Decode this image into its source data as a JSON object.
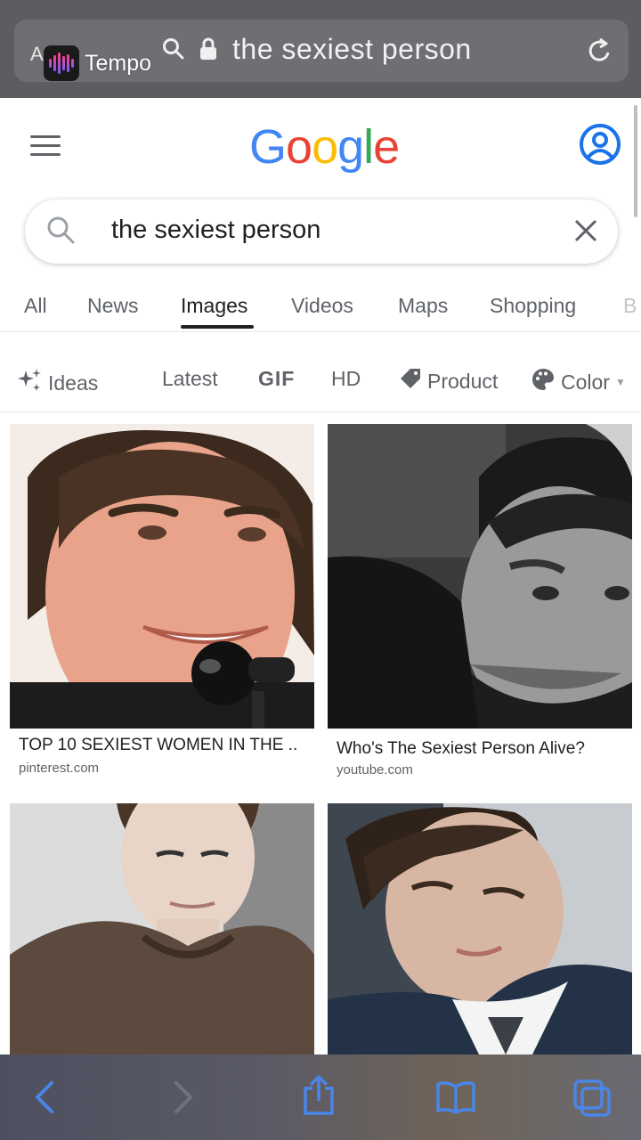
{
  "browser": {
    "aa_label": "A",
    "url_text": "the sexiest person",
    "overlay_app_name": "Tempo"
  },
  "google": {
    "logo_letters": [
      {
        "ch": "G",
        "color": "#4285f4"
      },
      {
        "ch": "o",
        "color": "#ea4335"
      },
      {
        "ch": "o",
        "color": "#fbbc05"
      },
      {
        "ch": "g",
        "color": "#4285f4"
      },
      {
        "ch": "l",
        "color": "#34a853"
      },
      {
        "ch": "e",
        "color": "#ea4335"
      }
    ],
    "search_query": "the sexiest person"
  },
  "tabs": [
    {
      "label": "All"
    },
    {
      "label": "News"
    },
    {
      "label": "Images",
      "active": true
    },
    {
      "label": "Videos"
    },
    {
      "label": "Maps"
    },
    {
      "label": "Shopping"
    },
    {
      "label": "B"
    }
  ],
  "chips": [
    {
      "label": "Ideas",
      "icon": "sparkle-icon"
    },
    {
      "label": "Latest"
    },
    {
      "label": "GIF"
    },
    {
      "label": "HD"
    },
    {
      "label": "Product",
      "icon": "tag-icon"
    },
    {
      "label": "Color",
      "icon": "palette-icon"
    }
  ],
  "results": [
    {
      "caption": "TOP 10 SEXIEST WOMEN IN THE ..",
      "source": "pinterest.com"
    },
    {
      "caption": "Who's The Sexiest Person Alive?",
      "source": "youtube.com"
    },
    {
      "caption": "",
      "source": ""
    },
    {
      "caption": "",
      "source": ""
    }
  ],
  "colors": {
    "accent_blue": "#1a73e8",
    "safari_icon_blue": "#4a86e8"
  }
}
